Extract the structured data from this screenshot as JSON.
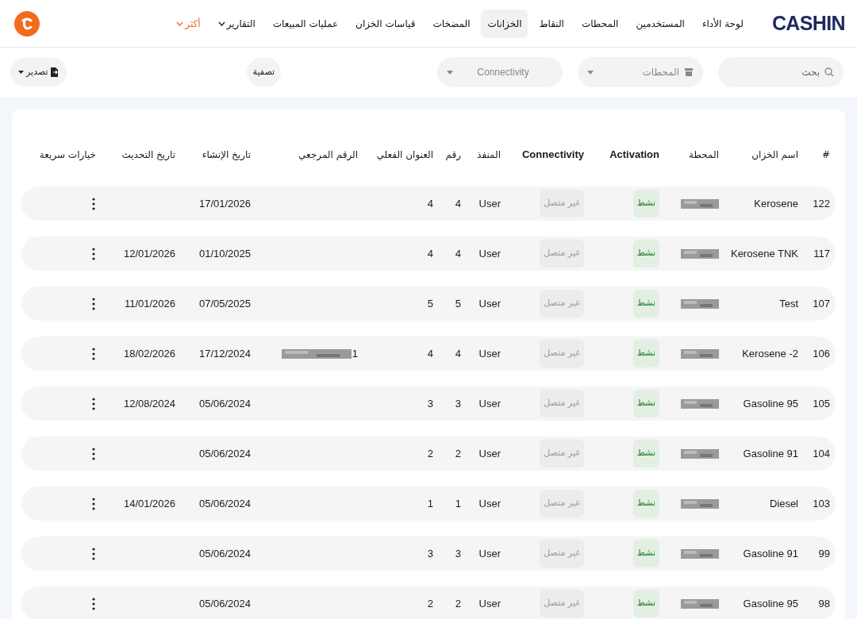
{
  "brand": "CASHIN",
  "nav": [
    {
      "label": "لوحة الأداء",
      "selected": false,
      "dropdown": false,
      "highlight": false
    },
    {
      "label": "المستخدمين",
      "selected": false,
      "dropdown": false,
      "highlight": false
    },
    {
      "label": "المحطات",
      "selected": false,
      "dropdown": false,
      "highlight": false
    },
    {
      "label": "النقاط",
      "selected": false,
      "dropdown": false,
      "highlight": false
    },
    {
      "label": "الخزانات",
      "selected": true,
      "dropdown": false,
      "highlight": false
    },
    {
      "label": "المضخات",
      "selected": false,
      "dropdown": false,
      "highlight": false
    },
    {
      "label": "قياسات الخزان",
      "selected": false,
      "dropdown": false,
      "highlight": false
    },
    {
      "label": "عمليات المبيعات",
      "selected": false,
      "dropdown": false,
      "highlight": false
    },
    {
      "label": "التقارير",
      "selected": false,
      "dropdown": true,
      "highlight": false
    },
    {
      "label": "أكثر",
      "selected": false,
      "dropdown": true,
      "highlight": true
    }
  ],
  "filters": {
    "search": {
      "placeholder": "بحث"
    },
    "stations": {
      "placeholder": "المحطات"
    },
    "connectivity": {
      "placeholder": "Connectivity"
    },
    "filter_button": "تصفية",
    "export_button": "تصدير"
  },
  "table": {
    "columns": [
      "#",
      "اسم الخزان",
      "المحطة",
      "Activation",
      "Connectivity",
      "المنفذ",
      "رقم",
      "العنوان الفعلي",
      "الرقم المرجعي",
      "تاريخ الإنشاء",
      "تاريخ التحديث",
      "خيارات سريعة"
    ],
    "rows": [
      {
        "id": "122",
        "name": "Kerosene",
        "station_blurred": true,
        "activation": "نشط",
        "active": true,
        "connectivity": "غير متصل",
        "connected": false,
        "port": "User",
        "number": "4",
        "address": "4",
        "created": "17/01/2026"
      },
      {
        "id": "117",
        "name": "Kerosene TNK",
        "station_blurred": true,
        "activation": "نشط",
        "active": true,
        "connectivity": "غير متصل",
        "connected": false,
        "port": "User",
        "number": "4",
        "address": "4",
        "created": "01/10/2025",
        "updated": "12/01/2026"
      },
      {
        "id": "107",
        "name": "Test",
        "station_blurred": true,
        "activation": "نشط",
        "active": true,
        "connectivity": "غير متصل",
        "connected": false,
        "port": "User",
        "number": "5",
        "address": "5",
        "created": "07/05/2025",
        "updated": "11/01/2026"
      },
      {
        "id": "106",
        "name": "Kerosene -2",
        "station_blurred": true,
        "activation": "نشط",
        "active": true,
        "connectivity": "غير متصل",
        "connected": false,
        "port": "User",
        "number": "4",
        "address": "4",
        "reference": "1",
        "reference_blurred": true,
        "created": "17/12/2024",
        "updated": "18/02/2026"
      },
      {
        "id": "105",
        "name": "Gasoline 95",
        "station_blurred": true,
        "activation": "نشط",
        "active": true,
        "connectivity": "غير متصل",
        "connected": false,
        "port": "User",
        "number": "3",
        "address": "3",
        "created": "05/06/2024",
        "updated": "12/08/2024"
      },
      {
        "id": "104",
        "name": "Gasoline 91",
        "station_blurred": true,
        "activation": "نشط",
        "active": true,
        "connectivity": "غير متصل",
        "connected": false,
        "port": "User",
        "number": "2",
        "address": "2",
        "created": "05/06/2024"
      },
      {
        "id": "103",
        "name": "Diesel",
        "station_blurred": true,
        "activation": "نشط",
        "active": true,
        "connectivity": "غير متصل",
        "connected": false,
        "port": "User",
        "number": "1",
        "address": "1",
        "created": "05/06/2024",
        "updated": "14/01/2026"
      },
      {
        "id": "99",
        "name": "Gasoline 91",
        "station_blurred": true,
        "activation": "نشط",
        "active": true,
        "connectivity": "غير متصل",
        "connected": false,
        "port": "User",
        "number": "3",
        "address": "3",
        "created": "05/06/2024"
      },
      {
        "id": "98",
        "name": "Gasoline 95",
        "station_blurred": true,
        "activation": "نشط",
        "active": true,
        "connectivity": "غير متصل",
        "connected": false,
        "port": "User",
        "number": "2",
        "address": "2",
        "created": "05/06/2024"
      }
    ]
  }
}
